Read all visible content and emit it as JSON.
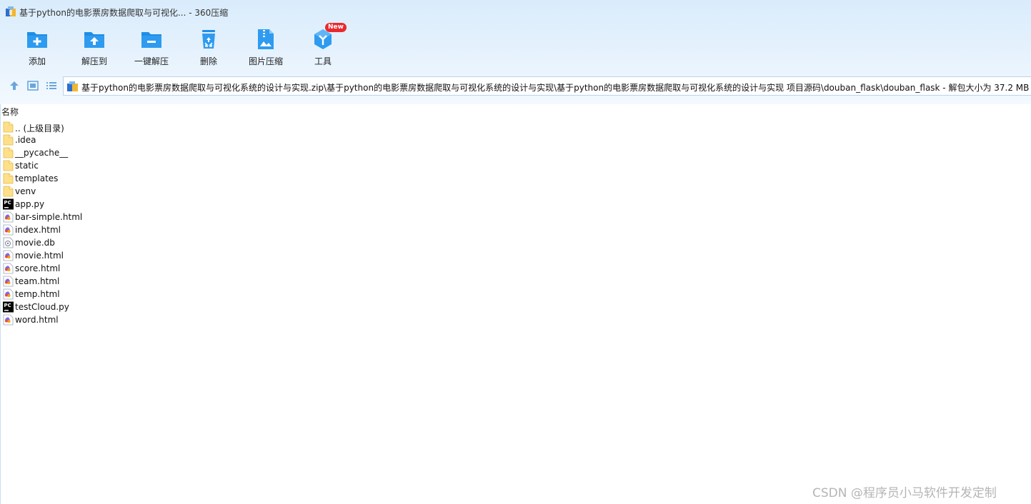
{
  "window": {
    "title": "基于python的电影票房数据爬取与可视化... - 360压缩"
  },
  "toolbar": {
    "buttons": [
      {
        "label": "添加",
        "icon": "add-folder-icon"
      },
      {
        "label": "解压到",
        "icon": "extract-to-icon"
      },
      {
        "label": "一键解压",
        "icon": "one-click-extract-icon"
      },
      {
        "label": "删除",
        "icon": "recycle-delete-icon"
      },
      {
        "label": "图片压缩",
        "icon": "image-compress-icon"
      },
      {
        "label": "工具",
        "icon": "tools-icon",
        "badge": "New"
      }
    ]
  },
  "nav": {
    "up_icon": "up-arrow-icon",
    "view_icon": "thumbnail-view-icon",
    "list_icon": "list-view-icon"
  },
  "path": {
    "text": "基于python的电影票房数据爬取与可视化系统的设计与实现.zip\\基于python的电影票房数据爬取与可视化系统的设计与实现\\基于python的电影票房数据爬取与可视化系统的设计与实现 项目源码\\douban_flask\\douban_flask - 解包大小为 37.2 MB"
  },
  "columns": {
    "name": "名称"
  },
  "files": [
    {
      "name": ".. (上级目录)",
      "type": "folder"
    },
    {
      "name": ".idea",
      "type": "folder"
    },
    {
      "name": "__pycache__",
      "type": "folder"
    },
    {
      "name": "static",
      "type": "folder"
    },
    {
      "name": "templates",
      "type": "folder"
    },
    {
      "name": "venv",
      "type": "folder"
    },
    {
      "name": "app.py",
      "type": "pycharm"
    },
    {
      "name": "bar-simple.html",
      "type": "html"
    },
    {
      "name": "index.html",
      "type": "html"
    },
    {
      "name": "movie.db",
      "type": "db"
    },
    {
      "name": "movie.html",
      "type": "html"
    },
    {
      "name": "score.html",
      "type": "html"
    },
    {
      "name": "team.html",
      "type": "html"
    },
    {
      "name": "temp.html",
      "type": "html"
    },
    {
      "name": "testCloud.py",
      "type": "pycharm"
    },
    {
      "name": "word.html",
      "type": "html"
    }
  ],
  "watermark": "CSDN @程序员小马软件开发定制",
  "colors": {
    "accent": "#1e8ee6",
    "topbar": "#dcedfc",
    "badge": "#e8292e"
  }
}
